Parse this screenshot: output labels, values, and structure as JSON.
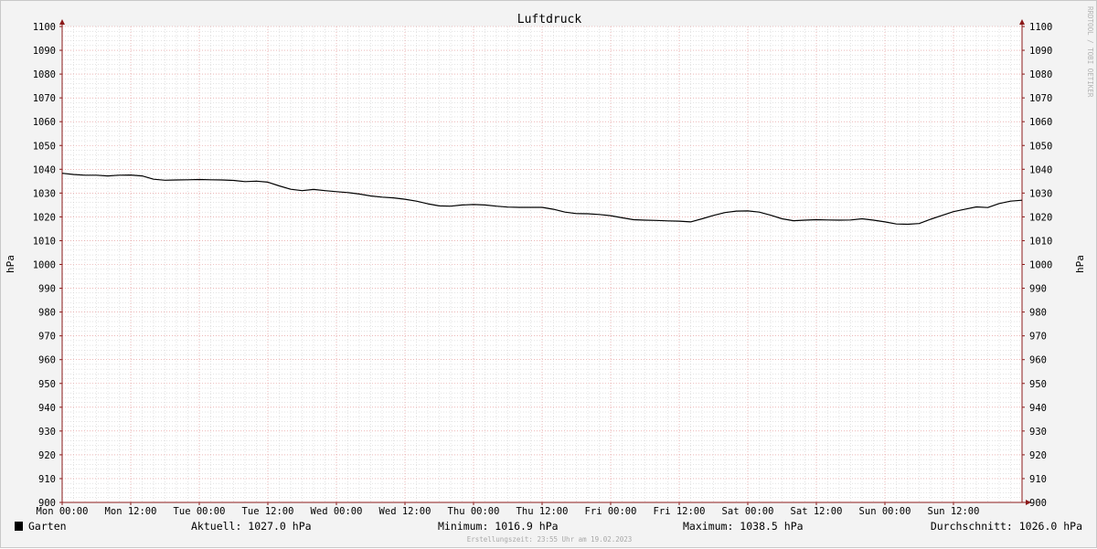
{
  "chart_data": {
    "type": "line",
    "title": "Luftdruck",
    "ylabel": "hPa",
    "ylabel_right": "hPa",
    "ylim": [
      900,
      1100
    ],
    "ytick_step": 10,
    "x_range_hours": [
      0,
      168
    ],
    "x_ticks": [
      {
        "label": "Mon 00:00",
        "hour": 0
      },
      {
        "label": "Mon 12:00",
        "hour": 12
      },
      {
        "label": "Tue 00:00",
        "hour": 24
      },
      {
        "label": "Tue 12:00",
        "hour": 36
      },
      {
        "label": "Wed 00:00",
        "hour": 48
      },
      {
        "label": "Wed 12:00",
        "hour": 60
      },
      {
        "label": "Thu 00:00",
        "hour": 72
      },
      {
        "label": "Thu 12:00",
        "hour": 84
      },
      {
        "label": "Fri 00:00",
        "hour": 96
      },
      {
        "label": "Fri 12:00",
        "hour": 108
      },
      {
        "label": "Sat 00:00",
        "hour": 120
      },
      {
        "label": "Sat 12:00",
        "hour": 132
      },
      {
        "label": "Sun 00:00",
        "hour": 144
      },
      {
        "label": "Sun 12:00",
        "hour": 156
      }
    ],
    "grid": true,
    "series": [
      {
        "name": "Garten",
        "color": "#000000",
        "points": [
          [
            0,
            1038.3
          ],
          [
            2,
            1037.8
          ],
          [
            4,
            1037.5
          ],
          [
            6,
            1037.5
          ],
          [
            8,
            1037.2
          ],
          [
            10,
            1037.5
          ],
          [
            12,
            1037.6
          ],
          [
            14,
            1037.2
          ],
          [
            16,
            1035.8
          ],
          [
            18,
            1035.4
          ],
          [
            20,
            1035.5
          ],
          [
            22,
            1035.6
          ],
          [
            24,
            1035.7
          ],
          [
            26,
            1035.6
          ],
          [
            28,
            1035.5
          ],
          [
            30,
            1035.3
          ],
          [
            32,
            1034.8
          ],
          [
            34,
            1035.0
          ],
          [
            36,
            1034.6
          ],
          [
            38,
            1033.0
          ],
          [
            40,
            1031.6
          ],
          [
            42,
            1031.0
          ],
          [
            44,
            1031.5
          ],
          [
            46,
            1031.0
          ],
          [
            48,
            1030.6
          ],
          [
            50,
            1030.2
          ],
          [
            52,
            1029.6
          ],
          [
            54,
            1028.8
          ],
          [
            56,
            1028.3
          ],
          [
            58,
            1028.0
          ],
          [
            60,
            1027.4
          ],
          [
            62,
            1026.6
          ],
          [
            64,
            1025.5
          ],
          [
            66,
            1024.6
          ],
          [
            68,
            1024.5
          ],
          [
            70,
            1025.0
          ],
          [
            72,
            1025.2
          ],
          [
            74,
            1025.0
          ],
          [
            76,
            1024.5
          ],
          [
            78,
            1024.1
          ],
          [
            80,
            1024.0
          ],
          [
            82,
            1024.0
          ],
          [
            84,
            1024.0
          ],
          [
            86,
            1023.2
          ],
          [
            88,
            1022.0
          ],
          [
            90,
            1021.4
          ],
          [
            92,
            1021.3
          ],
          [
            94,
            1021.0
          ],
          [
            96,
            1020.5
          ],
          [
            98,
            1019.6
          ],
          [
            100,
            1018.8
          ],
          [
            102,
            1018.6
          ],
          [
            104,
            1018.5
          ],
          [
            106,
            1018.3
          ],
          [
            108,
            1018.2
          ],
          [
            110,
            1017.9
          ],
          [
            112,
            1019.2
          ],
          [
            114,
            1020.6
          ],
          [
            116,
            1021.8
          ],
          [
            118,
            1022.4
          ],
          [
            120,
            1022.5
          ],
          [
            122,
            1022.0
          ],
          [
            124,
            1020.7
          ],
          [
            126,
            1019.2
          ],
          [
            128,
            1018.4
          ],
          [
            130,
            1018.6
          ],
          [
            132,
            1018.8
          ],
          [
            134,
            1018.7
          ],
          [
            136,
            1018.6
          ],
          [
            138,
            1018.7
          ],
          [
            140,
            1019.2
          ],
          [
            142,
            1018.6
          ],
          [
            144,
            1017.9
          ],
          [
            146,
            1017.0
          ],
          [
            148,
            1016.9
          ],
          [
            150,
            1017.2
          ],
          [
            152,
            1019.0
          ],
          [
            154,
            1020.6
          ],
          [
            156,
            1022.2
          ],
          [
            158,
            1023.2
          ],
          [
            160,
            1024.2
          ],
          [
            162,
            1023.9
          ],
          [
            164,
            1025.6
          ],
          [
            166,
            1026.6
          ],
          [
            168,
            1027.0
          ]
        ]
      }
    ]
  },
  "legend": {
    "series_name": "Garten",
    "series_color": "#000000",
    "current": "Aktuell: 1027.0 hPa",
    "minimum": "Minimum: 1016.9 hPa",
    "maximum": "Maximum: 1038.5 hPa",
    "average": "Durchschnitt: 1026.0 hPa"
  },
  "footer": "Erstellungszeit: 23:55 Uhr am 19.02.2023",
  "watermark": "RRDTOOL / TOBI OETIKER",
  "colors": {
    "background": "#f3f3f3",
    "plot_background": "#ffffff",
    "major_grid": "#e08a8a",
    "minor_grid": "#c8c8c8",
    "axis": "#8b1a1a",
    "line": "#000000"
  }
}
